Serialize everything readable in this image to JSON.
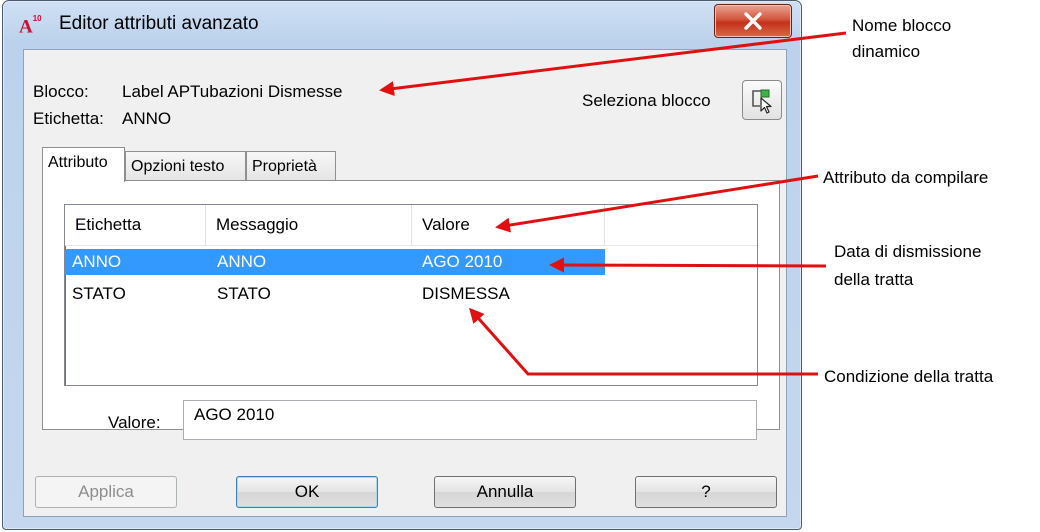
{
  "window": {
    "app_icon_text": "A",
    "app_icon_version": "10",
    "title": "Editor attributi avanzato"
  },
  "info": {
    "block_label": "Blocco:",
    "block_value": "Label APTubazioni Dismesse",
    "tag_label": "Etichetta:",
    "tag_value": "ANNO",
    "select_block_label": "Seleziona blocco"
  },
  "tabs": [
    {
      "label": "Attributo",
      "active": true
    },
    {
      "label": "Opzioni testo",
      "active": false
    },
    {
      "label": "Proprietà",
      "active": false
    }
  ],
  "list": {
    "columns": [
      "Etichetta",
      "Messaggio",
      "Valore"
    ],
    "rows": [
      {
        "tag": "ANNO",
        "prompt": "ANNO",
        "value": "AGO 2010",
        "selected": true
      },
      {
        "tag": "STATO",
        "prompt": "STATO",
        "value": "DISMESSA",
        "selected": false
      }
    ]
  },
  "value_field": {
    "label": "Valore:",
    "value": "AGO 2010"
  },
  "buttons": {
    "apply": "Applica",
    "ok": "OK",
    "cancel": "Annulla",
    "help": "?"
  },
  "annotations": {
    "block_name_line1": "Nome blocco",
    "block_name_line2": "dinamico",
    "attribute": "Attributo da compilare",
    "date_line1": "Data di dismissione",
    "date_line2": "della tratta",
    "condition": "Condizione della tratta"
  },
  "colors": {
    "selection": "#3399ff",
    "annotation_arrow": "#e01010",
    "close_button": "#c4301a"
  }
}
